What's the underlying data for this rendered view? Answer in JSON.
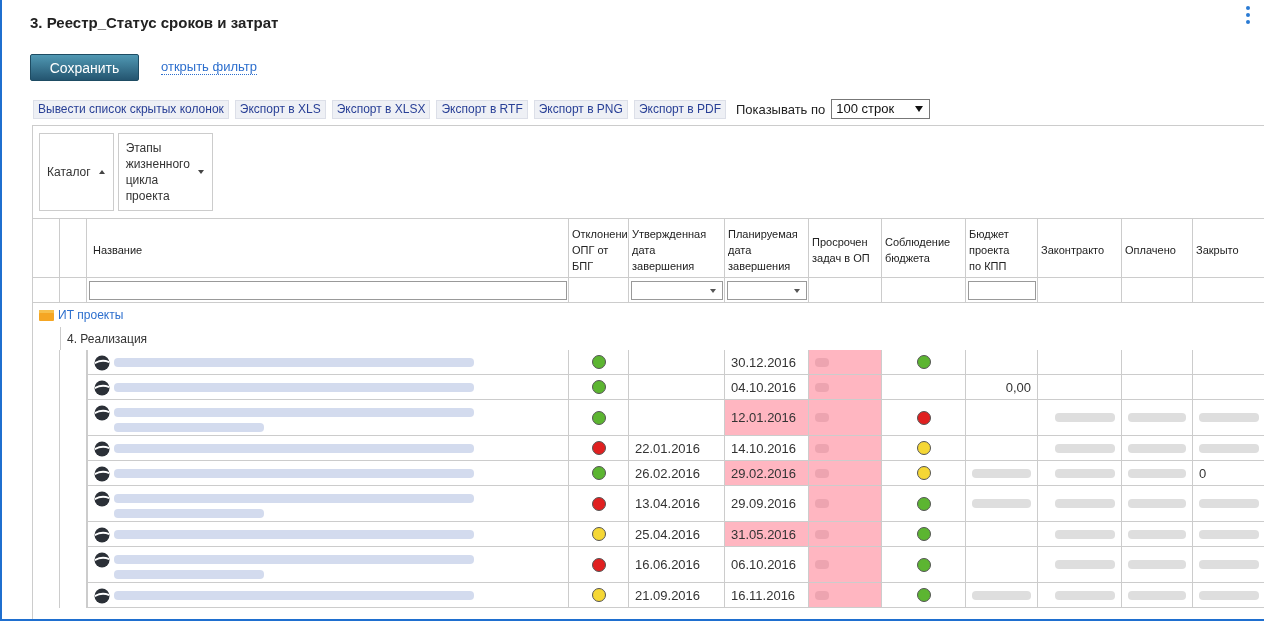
{
  "page": {
    "title": "3. Реестр_Статус сроков и затрат",
    "save_button": "Сохранить",
    "filter_link": "открыть фильтр"
  },
  "toolbar": {
    "buttons": [
      "Вывести список скрытых колонок",
      "Экспорт в XLS",
      "Экспорт в XLSX",
      "Экспорт в RTF",
      "Экспорт в PNG",
      "Экспорт в PDF"
    ],
    "page_size_label": "Показывать по",
    "page_size": "100 строк"
  },
  "grouping": [
    {
      "label": "Каталог",
      "kind": "ascending"
    },
    {
      "label": "Этапы\nжизненного\nцикла\nпроекта",
      "kind": "descending"
    }
  ],
  "table": {
    "columns": [
      {
        "label": "Название",
        "kind": "text"
      },
      {
        "label": "Отклонени\nОПГ от\nБПГ",
        "kind": "plain"
      },
      {
        "label": "Утвержденная\nдата\nзавершения",
        "kind": "dropdown"
      },
      {
        "label": "Планируемая\nдата\nзавершения",
        "kind": "dropdown"
      },
      {
        "label": "Просрочен\nзадач в ОП",
        "kind": "plain"
      },
      {
        "label": "Соблюдение\nбюджета",
        "kind": "plain"
      },
      {
        "label": "Бюджет\nпроекта\nпо КПП",
        "kind": "text"
      },
      {
        "label": "Законтракто",
        "kind": "plain"
      },
      {
        "label": "Оплачено",
        "kind": "plain"
      },
      {
        "label": "Закрыто",
        "kind": "plain"
      }
    ],
    "group": {
      "label": "ИТ проекты",
      "subgroup": "4. Реализация"
    },
    "rows": [
      {
        "cells": [
          {
            "blurred": true,
            "kind": "one-line"
          },
          {
            "color": "#5cb531"
          },
          {},
          {
            "text": "30.12.2016"
          },
          {
            "blurred": true,
            "highlighted": true
          },
          {
            "color": "#5cb531"
          },
          {},
          {},
          {},
          {}
        ]
      },
      {
        "cells": [
          {
            "blurred": true,
            "kind": "one-line"
          },
          {
            "color": "#5cb531"
          },
          {},
          {
            "text": "04.10.2016"
          },
          {
            "blurred": true,
            "highlighted": true
          },
          {},
          {
            "text": "0,00"
          },
          {},
          {},
          {}
        ]
      },
      {
        "cells": [
          {
            "blurred": true,
            "kind": "two-line"
          },
          {
            "color": "#5cb531"
          },
          {},
          {
            "text": "12.01.2016",
            "highlighted": true
          },
          {
            "blurred": true,
            "highlighted": true
          },
          {
            "color": "#e02020"
          },
          {},
          {
            "blurred": true
          },
          {
            "blurred": true
          },
          {
            "blurred": true
          }
        ]
      },
      {
        "cells": [
          {
            "blurred": true,
            "kind": "one-line"
          },
          {
            "color": "#e02020"
          },
          {
            "text": "22.01.2016"
          },
          {
            "text": "14.10.2016"
          },
          {
            "blurred": true,
            "highlighted": true
          },
          {
            "color": "#f5d735"
          },
          {},
          {
            "blurred": true
          },
          {
            "blurred": true
          },
          {
            "blurred": true
          }
        ]
      },
      {
        "cells": [
          {
            "blurred": true,
            "kind": "one-line"
          },
          {
            "color": "#5cb531"
          },
          {
            "text": "26.02.2016"
          },
          {
            "text": "29.02.2016",
            "highlighted": true
          },
          {
            "blurred": true,
            "highlighted": true
          },
          {
            "color": "#f5d735"
          },
          {
            "blurred": true
          },
          {
            "blurred": true
          },
          {
            "blurred": true
          },
          {
            "text": "0"
          }
        ]
      },
      {
        "cells": [
          {
            "blurred": true,
            "kind": "two-line"
          },
          {
            "color": "#e02020"
          },
          {
            "text": "13.04.2016"
          },
          {
            "text": "29.09.2016"
          },
          {
            "blurred": true,
            "highlighted": true
          },
          {
            "color": "#5cb531"
          },
          {
            "blurred": true
          },
          {
            "blurred": true
          },
          {
            "blurred": true
          },
          {
            "blurred": true
          }
        ]
      },
      {
        "cells": [
          {
            "blurred": true,
            "kind": "one-line"
          },
          {
            "color": "#f5d735"
          },
          {
            "text": "25.04.2016"
          },
          {
            "text": "31.05.2016",
            "highlighted": true
          },
          {
            "blurred": true,
            "highlighted": true
          },
          {
            "color": "#5cb531"
          },
          {},
          {
            "blurred": true
          },
          {
            "blurred": true
          },
          {
            "blurred": true
          }
        ]
      },
      {
        "cells": [
          {
            "blurred": true,
            "kind": "two-line"
          },
          {
            "color": "#e02020"
          },
          {
            "text": "16.06.2016"
          },
          {
            "text": "06.10.2016"
          },
          {
            "blurred": true,
            "highlighted": true
          },
          {
            "color": "#5cb531"
          },
          {},
          {
            "blurred": true
          },
          {
            "blurred": true
          },
          {
            "blurred": true
          }
        ]
      },
      {
        "cells": [
          {
            "blurred": true,
            "kind": "one-line"
          },
          {
            "color": "#f5d735"
          },
          {
            "text": "21.09.2016"
          },
          {
            "text": "16.11.2016"
          },
          {
            "blurred": true,
            "highlighted": true
          },
          {
            "color": "#5cb531"
          },
          {
            "blurred": true
          },
          {
            "blurred": true
          },
          {
            "blurred": true
          },
          {
            "blurred": true
          }
        ]
      }
    ]
  }
}
